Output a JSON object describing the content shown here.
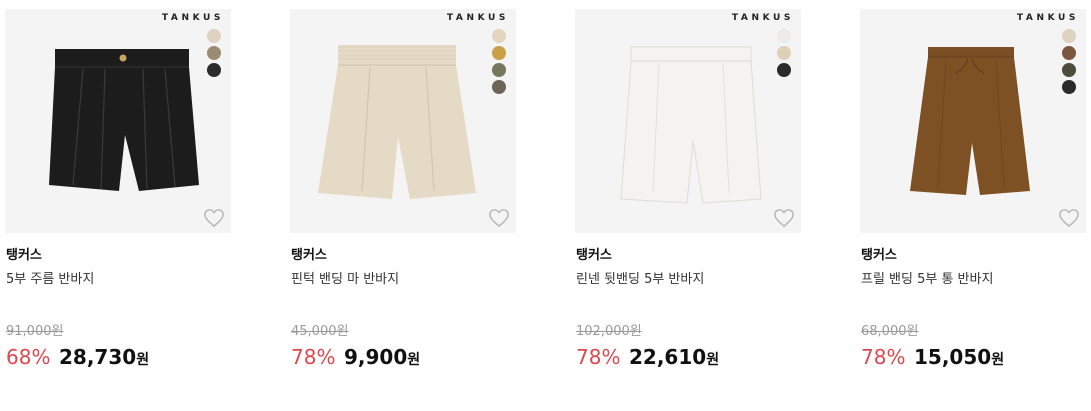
{
  "products": [
    {
      "logo": "TANKUS",
      "swatches": [
        "#ddd3c0",
        "#9b8b73",
        "#2b2b2b"
      ],
      "brand": "탱커스",
      "name": "5부 주름 반바지",
      "original_price": "91,000",
      "discount": "68%",
      "price": "28,730",
      "currency": "원",
      "garment_color": "#1c1c1c"
    },
    {
      "logo": "TANKUS",
      "swatches": [
        "#e2d6bf",
        "#c9a045",
        "#77765e",
        "#6e6457"
      ],
      "brand": "탱커스",
      "name": "핀턱 밴딩 마 반바지",
      "original_price": "45,000",
      "discount": "78%",
      "price": "9,900",
      "currency": "원",
      "garment_color": "#e4dac6"
    },
    {
      "logo": "TANKUS",
      "swatches": [
        "#ecebea",
        "#ddd0b6",
        "#2b2b2b"
      ],
      "brand": "탱커스",
      "name": "린넨 뒷밴딩 5부 반바지",
      "original_price": "102,000",
      "discount": "78%",
      "price": "22,610",
      "currency": "원",
      "garment_color": "#f4f3f0"
    },
    {
      "logo": "TANKUS",
      "swatches": [
        "#ded3c1",
        "#7b5740",
        "#4b4c3a",
        "#2b2b2b"
      ],
      "brand": "탱커스",
      "name": "프릴 밴딩 5부 통 반바지",
      "original_price": "68,000",
      "discount": "78%",
      "price": "15,050",
      "currency": "원",
      "garment_color": "#7e5125"
    }
  ]
}
